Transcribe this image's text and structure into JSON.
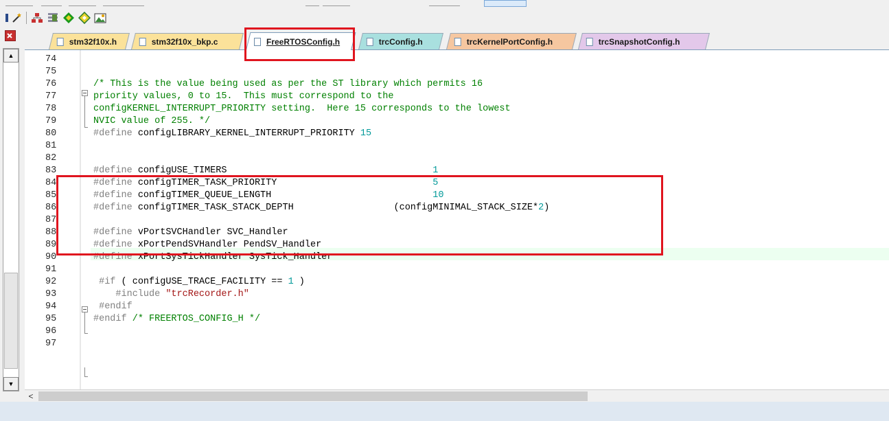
{
  "tabs": [
    {
      "label": "stm32f10x.h",
      "color": "#fbe29a",
      "active": false
    },
    {
      "label": "stm32f10x_bkp.c",
      "color": "#fbe29a",
      "active": false
    },
    {
      "label": "FreeRTOSConfig.h",
      "color": "#ffffff",
      "active": true
    },
    {
      "label": "trcConfig.h",
      "color": "#a9e0df",
      "active": false
    },
    {
      "label": "trcKernelPortConfig.h",
      "color": "#f6c7a0",
      "active": false
    },
    {
      "label": "trcSnapshotConfig.h",
      "color": "#e3c8ea",
      "active": false
    }
  ],
  "toolbar": {
    "icons": [
      "wizard-icon",
      "hierarchy-icon",
      "bookmark-list-icon",
      "green-diamond-icon",
      "outline-diamond-icon",
      "image-icon"
    ]
  },
  "editor": {
    "lines": [
      {
        "n": "74",
        "text": ""
      },
      {
        "n": "75",
        "text": ""
      },
      {
        "n": "76",
        "text": "/* This is the value being used as per the ST library which permits 16",
        "type": "comment"
      },
      {
        "n": "77",
        "text": "priority values, 0 to 15.  This must correspond to the",
        "type": "comment"
      },
      {
        "n": "78",
        "text": "configKERNEL_INTERRUPT_PRIORITY setting.  Here 15 corresponds to the lowest",
        "type": "comment"
      },
      {
        "n": "79",
        "text": "NVIC value of 255. */",
        "type": "comment"
      },
      {
        "n": "80",
        "kw": "#define",
        "ident": "configLIBRARY_KERNEL_INTERRUPT_PRIORITY",
        "val": "15"
      },
      {
        "n": "81",
        "text": ""
      },
      {
        "n": "82",
        "text": ""
      },
      {
        "n": "83",
        "kw": "#define",
        "ident": "configUSE_TIMERS",
        "val": "1"
      },
      {
        "n": "84",
        "kw": "#define",
        "ident": "configTIMER_TASK_PRIORITY",
        "val": "5"
      },
      {
        "n": "85",
        "kw": "#define",
        "ident": "configTIMER_QUEUE_LENGTH",
        "val": "10"
      },
      {
        "n": "86",
        "kw": "#define",
        "ident": "configTIMER_TASK_STACK_DEPTH",
        "val_pre": "(configMINIMAL_STACK_SIZE*",
        "val": "2",
        "val_post": ")"
      },
      {
        "n": "87",
        "text": ""
      },
      {
        "n": "88",
        "kw": "#define",
        "ident": "vPortSVCHandler SVC_Handler"
      },
      {
        "n": "89",
        "kw": "#define",
        "ident": "xPortPendSVHandler PendSV_Handler"
      },
      {
        "n": "90",
        "kw": "#define",
        "ident": "xPortSysTickHandler SysTick_Handler"
      },
      {
        "n": "91",
        "text": ""
      },
      {
        "n": "92",
        "kw": "#if",
        "ident": "( configUSE_TRACE_FACILITY ==",
        "val": "1",
        "val_post": " )"
      },
      {
        "n": "93",
        "kw": "#include",
        "str": "\"trcRecorder.h\""
      },
      {
        "n": "94",
        "kw": "#endif"
      },
      {
        "n": "95",
        "kw": "#endif",
        "cmt": "/* FREERTOS_CONFIG_H */"
      },
      {
        "n": "96",
        "text": ""
      },
      {
        "n": "97",
        "text": ""
      }
    ]
  },
  "hscroll": {
    "left_arrow": "<"
  },
  "vscroll": {
    "up": "▲",
    "down": "▼"
  }
}
